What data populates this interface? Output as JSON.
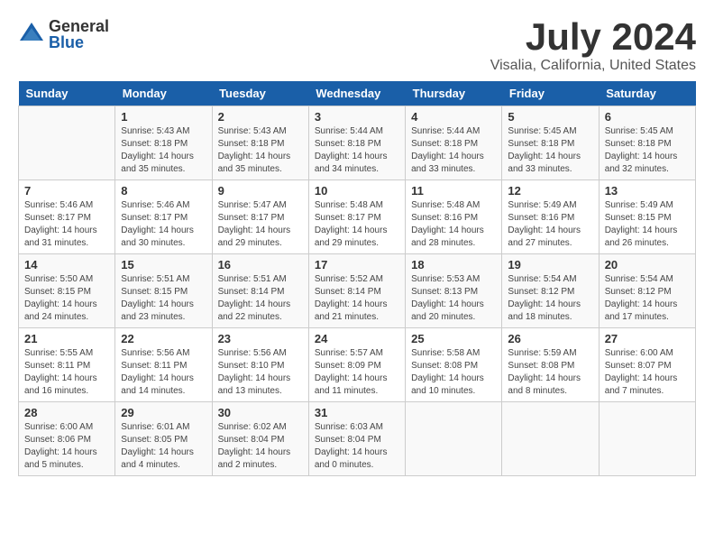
{
  "logo": {
    "general": "General",
    "blue": "Blue"
  },
  "title": "July 2024",
  "location": "Visalia, California, United States",
  "days_of_week": [
    "Sunday",
    "Monday",
    "Tuesday",
    "Wednesday",
    "Thursday",
    "Friday",
    "Saturday"
  ],
  "weeks": [
    [
      {
        "day": "",
        "content": ""
      },
      {
        "day": "1",
        "content": "Sunrise: 5:43 AM\nSunset: 8:18 PM\nDaylight: 14 hours\nand 35 minutes."
      },
      {
        "day": "2",
        "content": "Sunrise: 5:43 AM\nSunset: 8:18 PM\nDaylight: 14 hours\nand 35 minutes."
      },
      {
        "day": "3",
        "content": "Sunrise: 5:44 AM\nSunset: 8:18 PM\nDaylight: 14 hours\nand 34 minutes."
      },
      {
        "day": "4",
        "content": "Sunrise: 5:44 AM\nSunset: 8:18 PM\nDaylight: 14 hours\nand 33 minutes."
      },
      {
        "day": "5",
        "content": "Sunrise: 5:45 AM\nSunset: 8:18 PM\nDaylight: 14 hours\nand 33 minutes."
      },
      {
        "day": "6",
        "content": "Sunrise: 5:45 AM\nSunset: 8:18 PM\nDaylight: 14 hours\nand 32 minutes."
      }
    ],
    [
      {
        "day": "7",
        "content": "Sunrise: 5:46 AM\nSunset: 8:17 PM\nDaylight: 14 hours\nand 31 minutes."
      },
      {
        "day": "8",
        "content": "Sunrise: 5:46 AM\nSunset: 8:17 PM\nDaylight: 14 hours\nand 30 minutes."
      },
      {
        "day": "9",
        "content": "Sunrise: 5:47 AM\nSunset: 8:17 PM\nDaylight: 14 hours\nand 29 minutes."
      },
      {
        "day": "10",
        "content": "Sunrise: 5:48 AM\nSunset: 8:17 PM\nDaylight: 14 hours\nand 29 minutes."
      },
      {
        "day": "11",
        "content": "Sunrise: 5:48 AM\nSunset: 8:16 PM\nDaylight: 14 hours\nand 28 minutes."
      },
      {
        "day": "12",
        "content": "Sunrise: 5:49 AM\nSunset: 8:16 PM\nDaylight: 14 hours\nand 27 minutes."
      },
      {
        "day": "13",
        "content": "Sunrise: 5:49 AM\nSunset: 8:15 PM\nDaylight: 14 hours\nand 26 minutes."
      }
    ],
    [
      {
        "day": "14",
        "content": "Sunrise: 5:50 AM\nSunset: 8:15 PM\nDaylight: 14 hours\nand 24 minutes."
      },
      {
        "day": "15",
        "content": "Sunrise: 5:51 AM\nSunset: 8:15 PM\nDaylight: 14 hours\nand 23 minutes."
      },
      {
        "day": "16",
        "content": "Sunrise: 5:51 AM\nSunset: 8:14 PM\nDaylight: 14 hours\nand 22 minutes."
      },
      {
        "day": "17",
        "content": "Sunrise: 5:52 AM\nSunset: 8:14 PM\nDaylight: 14 hours\nand 21 minutes."
      },
      {
        "day": "18",
        "content": "Sunrise: 5:53 AM\nSunset: 8:13 PM\nDaylight: 14 hours\nand 20 minutes."
      },
      {
        "day": "19",
        "content": "Sunrise: 5:54 AM\nSunset: 8:12 PM\nDaylight: 14 hours\nand 18 minutes."
      },
      {
        "day": "20",
        "content": "Sunrise: 5:54 AM\nSunset: 8:12 PM\nDaylight: 14 hours\nand 17 minutes."
      }
    ],
    [
      {
        "day": "21",
        "content": "Sunrise: 5:55 AM\nSunset: 8:11 PM\nDaylight: 14 hours\nand 16 minutes."
      },
      {
        "day": "22",
        "content": "Sunrise: 5:56 AM\nSunset: 8:11 PM\nDaylight: 14 hours\nand 14 minutes."
      },
      {
        "day": "23",
        "content": "Sunrise: 5:56 AM\nSunset: 8:10 PM\nDaylight: 14 hours\nand 13 minutes."
      },
      {
        "day": "24",
        "content": "Sunrise: 5:57 AM\nSunset: 8:09 PM\nDaylight: 14 hours\nand 11 minutes."
      },
      {
        "day": "25",
        "content": "Sunrise: 5:58 AM\nSunset: 8:08 PM\nDaylight: 14 hours\nand 10 minutes."
      },
      {
        "day": "26",
        "content": "Sunrise: 5:59 AM\nSunset: 8:08 PM\nDaylight: 14 hours\nand 8 minutes."
      },
      {
        "day": "27",
        "content": "Sunrise: 6:00 AM\nSunset: 8:07 PM\nDaylight: 14 hours\nand 7 minutes."
      }
    ],
    [
      {
        "day": "28",
        "content": "Sunrise: 6:00 AM\nSunset: 8:06 PM\nDaylight: 14 hours\nand 5 minutes."
      },
      {
        "day": "29",
        "content": "Sunrise: 6:01 AM\nSunset: 8:05 PM\nDaylight: 14 hours\nand 4 minutes."
      },
      {
        "day": "30",
        "content": "Sunrise: 6:02 AM\nSunset: 8:04 PM\nDaylight: 14 hours\nand 2 minutes."
      },
      {
        "day": "31",
        "content": "Sunrise: 6:03 AM\nSunset: 8:04 PM\nDaylight: 14 hours\nand 0 minutes."
      },
      {
        "day": "",
        "content": ""
      },
      {
        "day": "",
        "content": ""
      },
      {
        "day": "",
        "content": ""
      }
    ]
  ]
}
